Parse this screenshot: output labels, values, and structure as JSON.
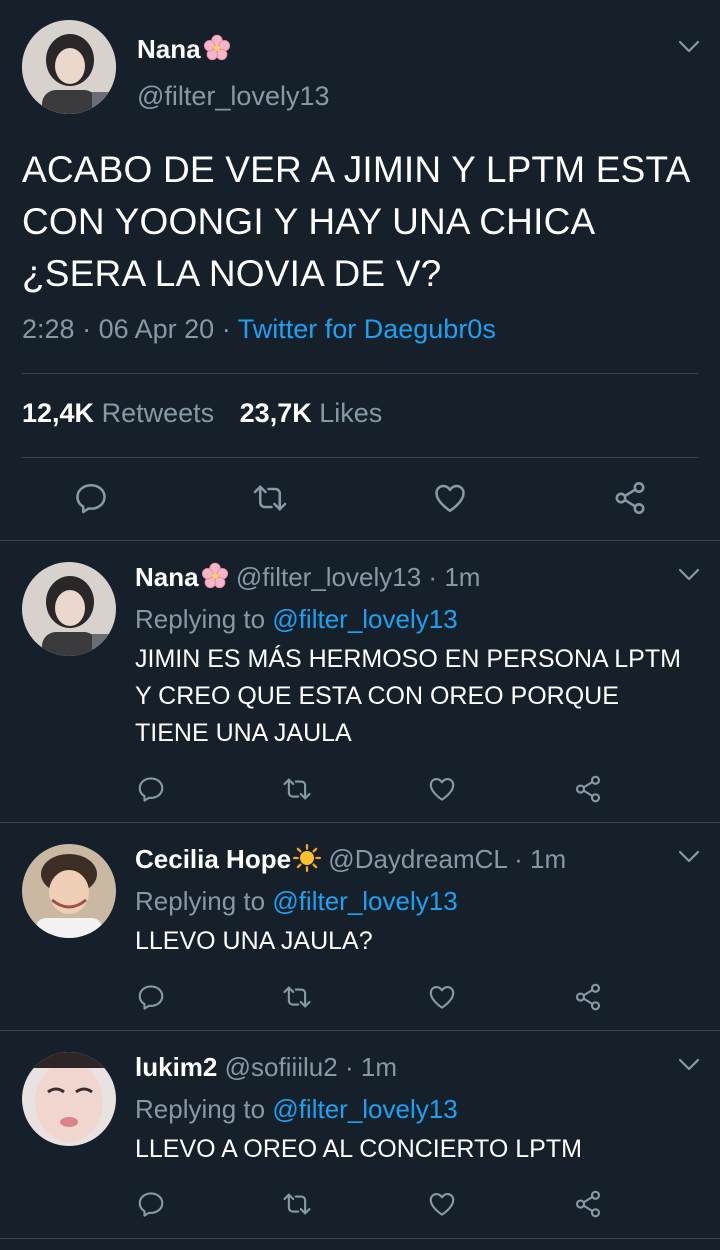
{
  "main_tweet": {
    "name": "Nana",
    "handle": "@filter_lovely13",
    "text": "ACABO DE VER A JIMIN Y LPTM ESTA CON YOONGI Y HAY UNA CHICA ¿SERA LA NOVIA DE V?",
    "time": "2:28",
    "date": "06 Apr 20",
    "source": "Twitter for Daegubr0s",
    "retweets_count": "12,4K",
    "retweets_label": "Retweets",
    "likes_count": "23,7K",
    "likes_label": "Likes"
  },
  "replies": [
    {
      "name": "Nana",
      "handle": "@filter_lovely13",
      "time": "1m",
      "replying_label": "Replying to",
      "replying_to": "@filter_lovely13",
      "text": "JIMIN ES MÁS HERMOSO EN PERSONA LPTM Y CREO QUE ESTA CON OREO PORQUE TIENE UNA JAULA"
    },
    {
      "name": "Cecilia Hope",
      "handle": "@DaydreamCL",
      "time": "1m",
      "replying_label": "Replying to",
      "replying_to": "@filter_lovely13",
      "text": "LLEVO UNA JAULA?"
    },
    {
      "name": "lukim2",
      "handle": "@sofiiilu2",
      "time": "1m",
      "replying_label": "Replying to",
      "replying_to": "@filter_lovely13",
      "text": "LLEVO A OREO AL CONCIERTO LPTM"
    }
  ],
  "separator": "·",
  "icons": [
    "chevron-down-icon",
    "reply-icon",
    "retweet-icon",
    "like-icon",
    "share-icon",
    "cherry-blossom-icon",
    "sun-icon"
  ],
  "colors": {
    "background": "#15202b",
    "accent": "#1da1f2",
    "muted": "#8899a6",
    "divider": "#38444d"
  }
}
